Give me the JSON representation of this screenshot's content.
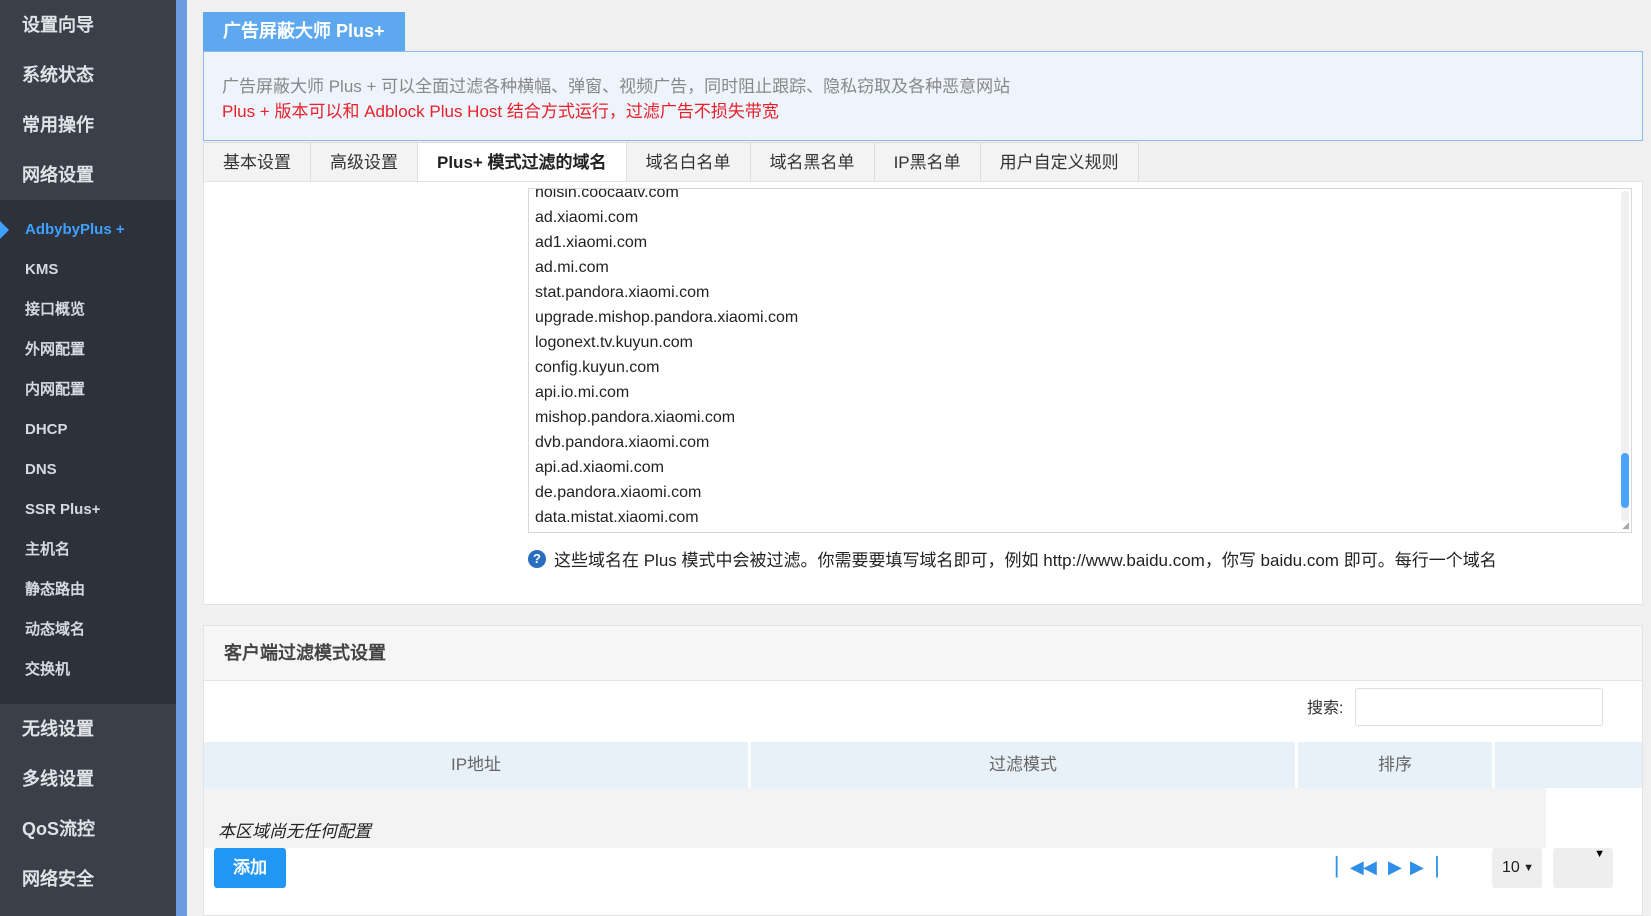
{
  "sidebar": {
    "top_items": [
      "设置向导",
      "系统状态",
      "常用操作",
      "网络设置"
    ],
    "sub_items": [
      "AdbybyPlus +",
      "KMS",
      "接口概览",
      "外网配置",
      "内网配置",
      "DHCP",
      "DNS",
      "SSR Plus+",
      "主机名",
      "静态路由",
      "动态域名",
      "交换机"
    ],
    "active_sub": "AdbybyPlus +",
    "bottom_items": [
      "无线设置",
      "多线设置",
      "QoS流控",
      "网络安全"
    ]
  },
  "header": {
    "title": "广告屏蔽大师 Plus+",
    "desc_line1": "广告屏蔽大师 Plus + 可以全面过滤各种横幅、弹窗、视频广告，同时阻止跟踪、隐私窃取及各种恶意网站",
    "desc_line2": "Plus + 版本可以和 Adblock Plus Host 结合方式运行，过滤广告不损失带宽"
  },
  "tabs": [
    "基本设置",
    "高级设置",
    "Plus+ 模式过滤的域名",
    "域名白名单",
    "域名黑名单",
    "IP黑名单",
    "用户自定义规则"
  ],
  "active_tab": "Plus+ 模式过滤的域名",
  "domains": [
    "hoisin.coocaatv.com",
    "ad.xiaomi.com",
    "ad1.xiaomi.com",
    "ad.mi.com",
    "stat.pandora.xiaomi.com",
    "upgrade.mishop.pandora.xiaomi.com",
    "logonext.tv.kuyun.com",
    "config.kuyun.com",
    "api.io.mi.com",
    "mishop.pandora.xiaomi.com",
    "dvb.pandora.xiaomi.com",
    "api.ad.xiaomi.com",
    "de.pandora.xiaomi.com",
    "data.mistat.xiaomi.com"
  ],
  "help_icon": "?",
  "help_text": "这些域名在 Plus 模式中会被过滤。你需要要填写域名即可，例如 http://www.baidu.com，你写 baidu.com 即可。每行一个域名",
  "client": {
    "title": "客户端过滤模式设置",
    "search_label": "搜索:",
    "columns": [
      "IP地址",
      "过滤模式",
      "排序"
    ],
    "empty_text": "本区域尚无任何配置",
    "add_label": "添加",
    "page_size": "10"
  },
  "colors": {
    "accent": "#2196f3",
    "sidebar_bg": "#3a3f48",
    "warning_text": "#e8202a"
  }
}
